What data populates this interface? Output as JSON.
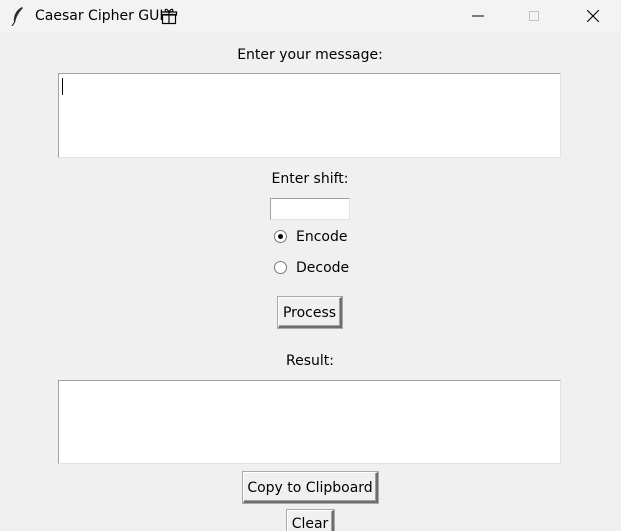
{
  "window": {
    "title": "Caesar Cipher GUI",
    "icon": "feather-icon",
    "title_icon": "gift-icon",
    "controls": [
      "minimize",
      "maximize",
      "close"
    ]
  },
  "message": {
    "label": "Enter your message:",
    "value": ""
  },
  "shift": {
    "label": "Enter shift:",
    "value": ""
  },
  "mode": {
    "options": [
      {
        "label": "Encode",
        "selected": true
      },
      {
        "label": "Decode",
        "selected": false
      }
    ]
  },
  "buttons": {
    "process": "Process",
    "copy": "Copy to Clipboard",
    "clear": "Clear"
  },
  "result": {
    "label": "Result:",
    "value": ""
  }
}
